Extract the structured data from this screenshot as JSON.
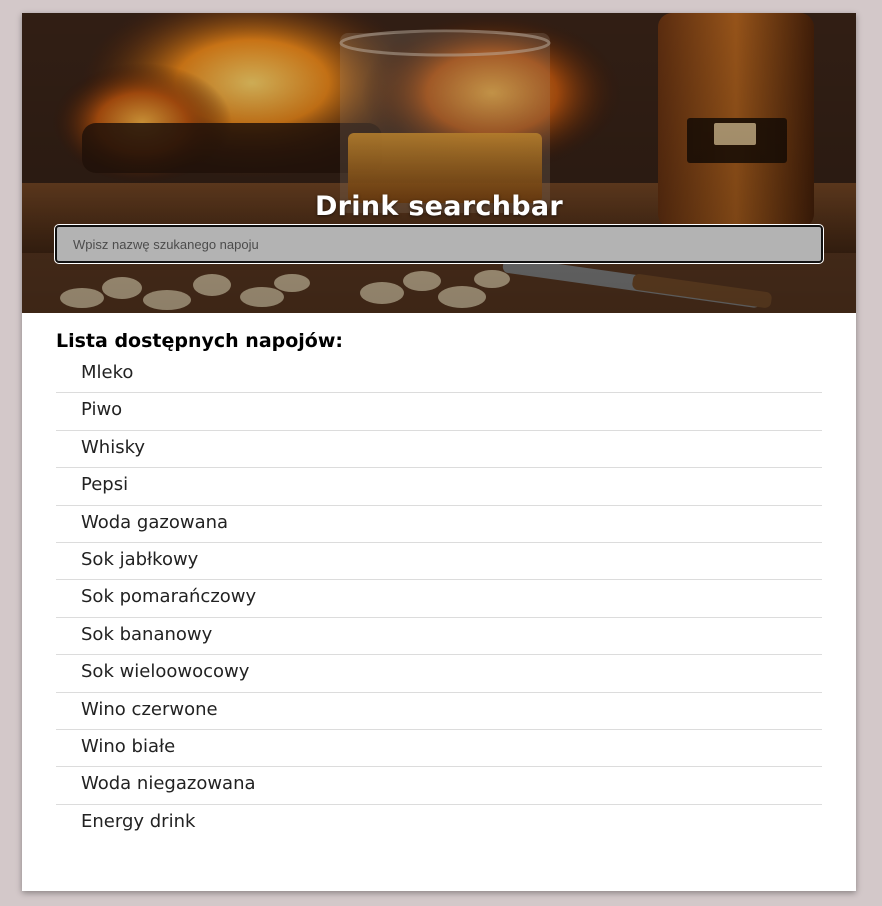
{
  "header": {
    "title": "Drink searchbar"
  },
  "search": {
    "placeholder": "Wpisz nazwę szukanego napoju",
    "value": ""
  },
  "list": {
    "heading": "Lista dostępnych napojów:",
    "items": [
      "Mleko",
      "Piwo",
      "Whisky",
      "Pepsi",
      "Woda gazowana",
      "Sok jabłkowy",
      "Sok pomarańczowy",
      "Sok bananowy",
      "Sok wieloowocowy",
      "Wino czerwone",
      "Wino białe",
      "Woda niegazowana",
      "Energy drink"
    ]
  },
  "colors": {
    "page_background": "#d3c8c9",
    "card_background": "#ffffff",
    "search_background": "#b3b3b3"
  }
}
